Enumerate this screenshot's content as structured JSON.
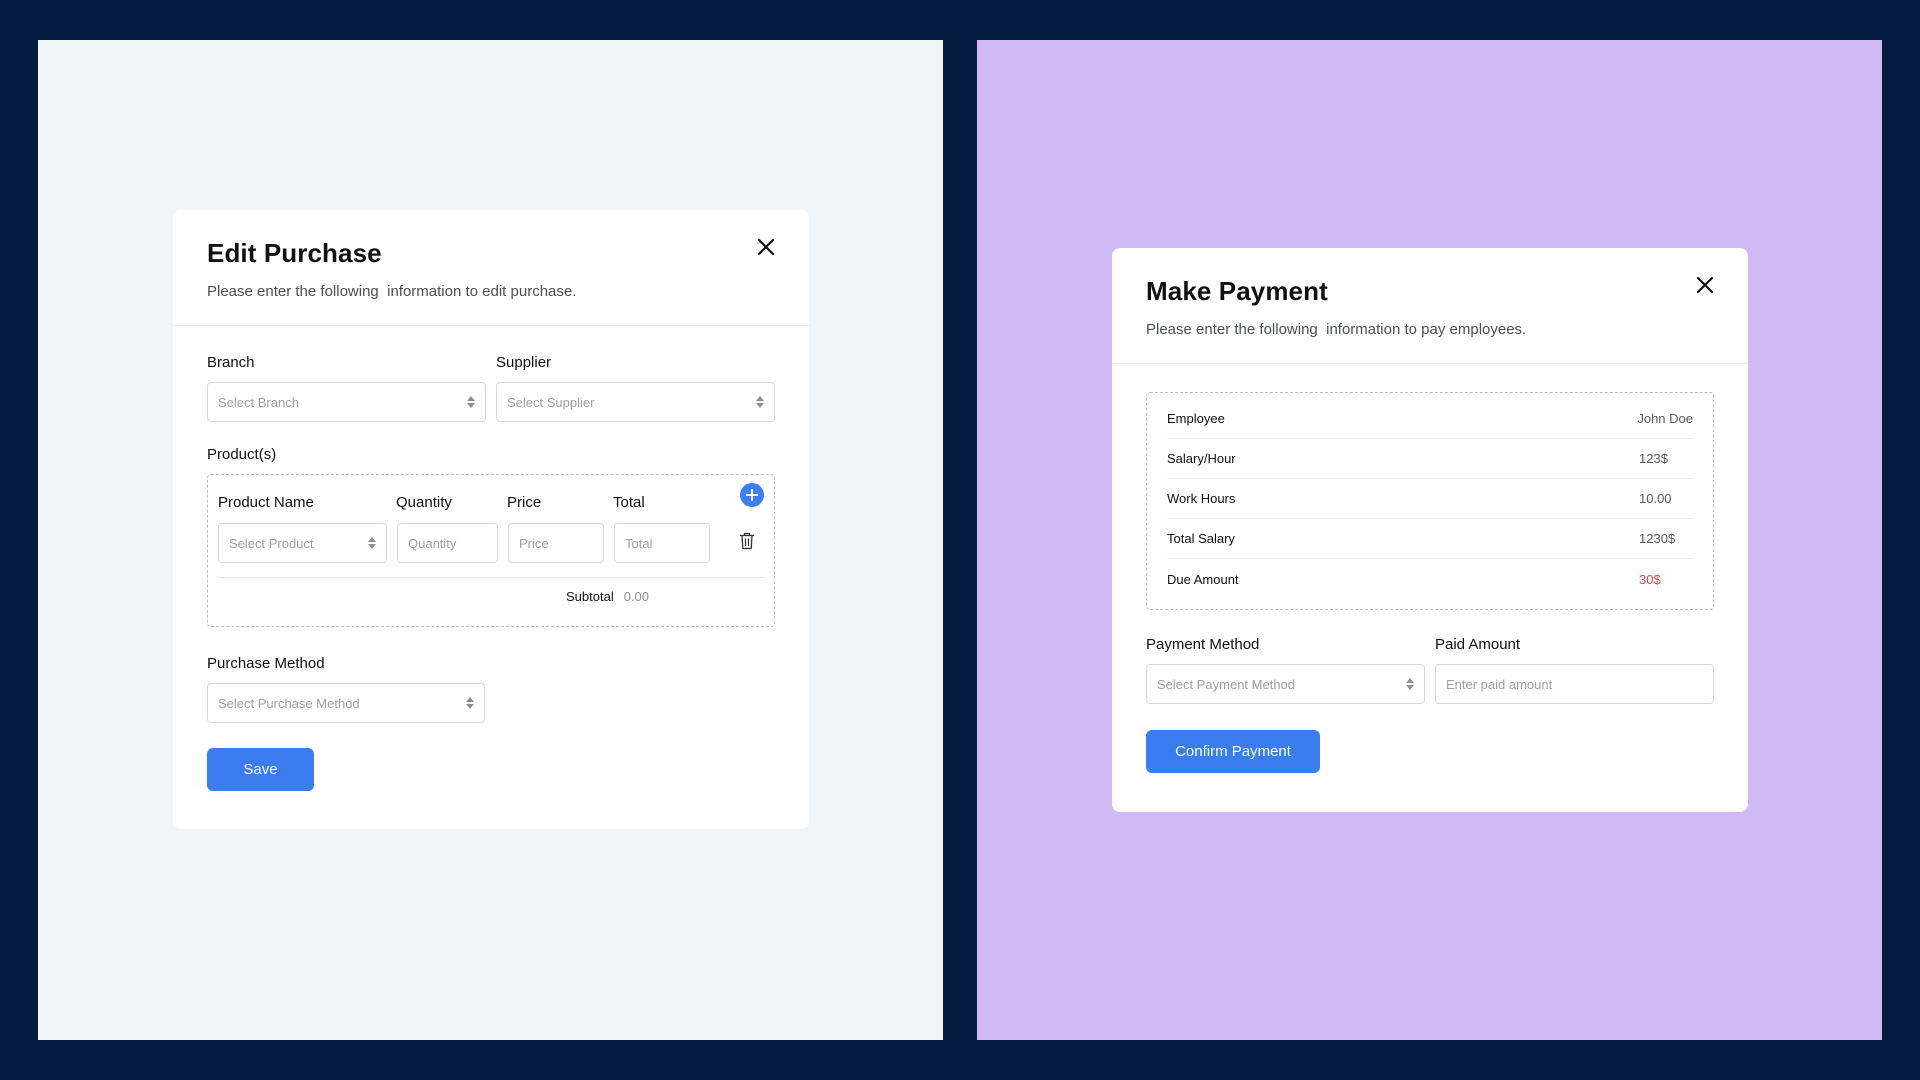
{
  "colors": {
    "page_bg": "#031c40",
    "left_panel_bg": "#f1f5f8",
    "right_panel_bg": "#d0b9f4",
    "primary": "#3a7df0",
    "due_red": "#e0474b"
  },
  "edit_purchase": {
    "title": "Edit Purchase",
    "subtitle": "Please enter the following  information to edit purchase.",
    "close_icon": "close-icon",
    "branch": {
      "label": "Branch",
      "placeholder": "Select Branch"
    },
    "supplier": {
      "label": "Supplier",
      "placeholder": "Select Supplier"
    },
    "products": {
      "label": "Product(s)",
      "columns": [
        "Product Name",
        "Quantity",
        "Price",
        "Total"
      ],
      "row": {
        "product_placeholder": "Select Product",
        "quantity_placeholder": "Quantity",
        "price_placeholder": "Price",
        "total_placeholder": "Total"
      },
      "add_icon": "plus-circle-icon",
      "delete_icon": "trash-icon",
      "subtotal_label": "Subtotal",
      "subtotal_value": "0.00"
    },
    "purchase_method": {
      "label": "Purchase Method",
      "placeholder": "Select Purchase Method"
    },
    "save_label": "Save"
  },
  "make_payment": {
    "title": "Make Payment",
    "subtitle": "Please enter the following  information to pay employees.",
    "close_icon": "close-icon",
    "details": [
      {
        "label": "Employee",
        "value": "John Doe"
      },
      {
        "label": "Salary/Hour",
        "value": "123$"
      },
      {
        "label": "Work Hours",
        "value": "10.00"
      },
      {
        "label": "Total Salary",
        "value": "1230$"
      },
      {
        "label": "Due Amount",
        "value": "30$"
      }
    ],
    "payment_method": {
      "label": "Payment Method",
      "placeholder": "Select Payment Method"
    },
    "paid_amount": {
      "label": "Paid Amount",
      "placeholder": "Enter paid amount"
    },
    "confirm_label": "Confirm Payment"
  }
}
